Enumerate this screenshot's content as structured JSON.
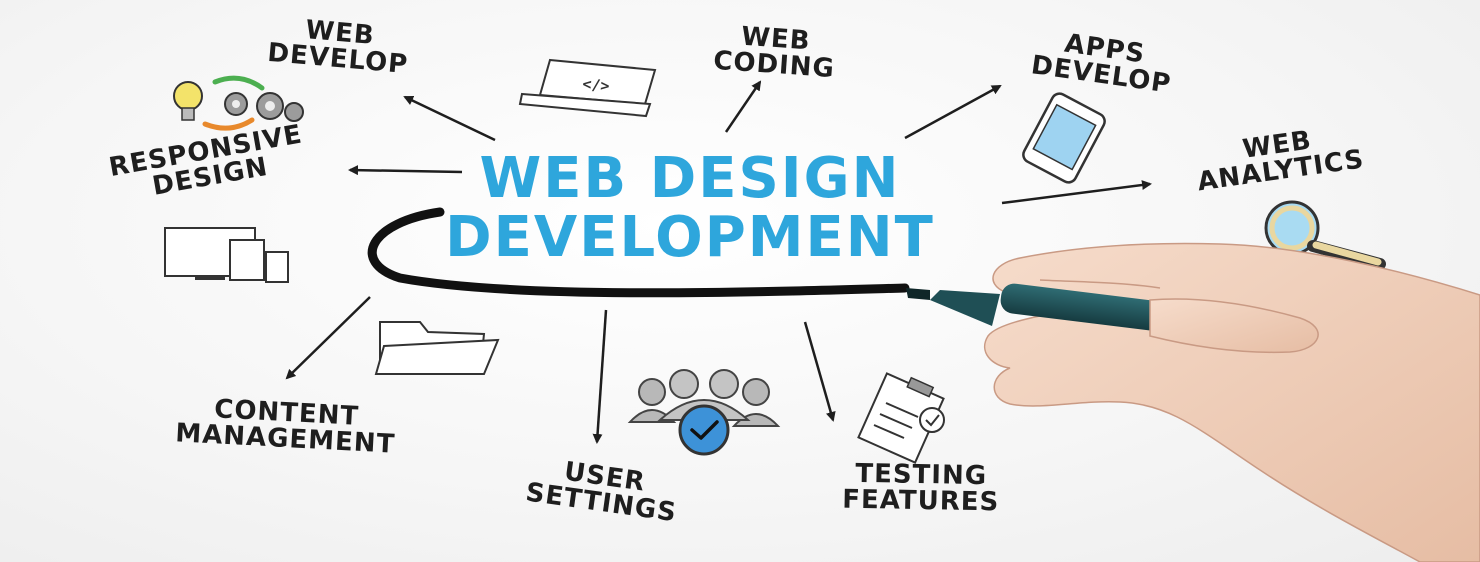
{
  "title": {
    "line1": "WEB DESIGN",
    "line2": "DEVELOPMENT"
  },
  "nodes": {
    "web_develop": {
      "line1": "WEB",
      "line2": "DEVELOP"
    },
    "web_coding": {
      "line1": "WEB",
      "line2": "CODING"
    },
    "apps_develop": {
      "line1": "APPS",
      "line2": "DEVELOP"
    },
    "web_analytics": {
      "line1": "WEB",
      "line2": "ANALYTICS"
    },
    "responsive_design": {
      "line1": "RESPONSIVE",
      "line2": "DESIGN"
    },
    "content_management": {
      "line1": "CONTENT",
      "line2": "MANAGEMENT"
    },
    "user_settings": {
      "line1": "USER",
      "line2": "SETTINGS"
    },
    "testing_features": {
      "line1": "TESTING",
      "line2": "FEATURES"
    }
  },
  "icons": {
    "laptop_code": "</>"
  },
  "colors": {
    "accent": "#2ea6dc",
    "ink": "#1e1e1e",
    "marker": "#1f4f55"
  }
}
